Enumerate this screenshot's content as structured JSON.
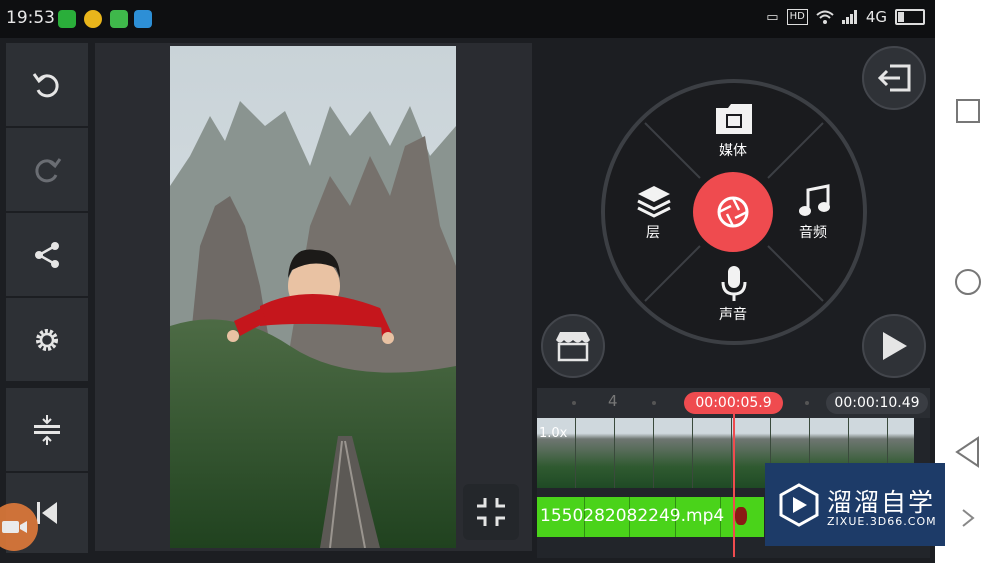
{
  "status_bar": {
    "time": "19:53",
    "hd_badge": "HD",
    "network": "4G"
  },
  "toolbar": {
    "undo": "undo-icon",
    "redo": "redo-icon",
    "share": "share-icon",
    "settings": "gear-icon",
    "adjust": "adjust-split-icon",
    "rewind": "skip-back-icon"
  },
  "wheel": {
    "media": "媒体",
    "layer": "层",
    "audio": "音频",
    "voice": "声音"
  },
  "timeline": {
    "marker": "4",
    "playhead_time": "00:00:05.9",
    "end_time": "00:00:10.49",
    "speed": "1.0x",
    "clip_name": "1550282082249.mp4"
  },
  "watermark": {
    "title": "溜溜自学",
    "url": "ZIXUE.3D66.COM"
  },
  "colors": {
    "accent": "#ef4b4f",
    "clip_green": "#4ad31a",
    "panel": "#2d3035"
  }
}
